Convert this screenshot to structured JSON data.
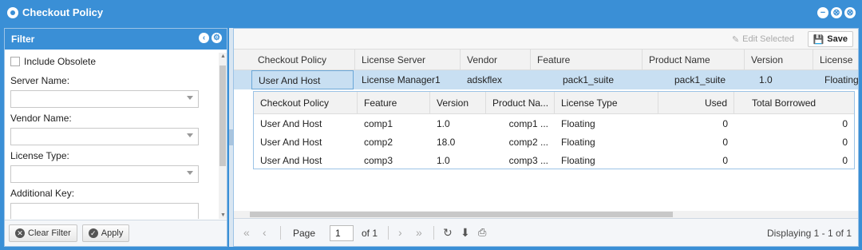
{
  "window": {
    "title": "Checkout Policy",
    "buttons": [
      "−",
      "⊗",
      "⊗"
    ]
  },
  "filter": {
    "title": "Filter",
    "include_obsolete": "Include Obsolete",
    "fields": [
      {
        "label": "Server Name:",
        "value": ""
      },
      {
        "label": "Vendor Name:",
        "value": ""
      },
      {
        "label": "License Type:",
        "value": ""
      },
      {
        "label": "Additional Key:",
        "value": ""
      }
    ],
    "clear_label": "Clear Filter",
    "apply_label": "Apply"
  },
  "toolbar": {
    "edit_label": "Edit Selected",
    "save_label": "Save"
  },
  "grid": {
    "columns": [
      "Checkout Policy",
      "License Server",
      "Vendor",
      "Feature",
      "Product Name",
      "Version",
      "License"
    ],
    "row": [
      "User And Host",
      "License Manager1",
      "adskflex",
      "pack1_suite",
      "pack1_suite",
      "1.0",
      "Floating"
    ]
  },
  "subgrid": {
    "columns": [
      "Checkout Policy",
      "Feature",
      "Version",
      "Product Na...",
      "License Type",
      "Used",
      "Total Borrowed"
    ],
    "rows": [
      [
        "User And Host",
        "comp1",
        "1.0",
        "comp1 ...",
        "Floating",
        "0",
        "0"
      ],
      [
        "User And Host",
        "comp2",
        "18.0",
        "comp2 ...",
        "Floating",
        "0",
        "0"
      ],
      [
        "User And Host",
        "comp3",
        "1.0",
        "comp3 ...",
        "Floating",
        "0",
        "0"
      ]
    ]
  },
  "pager": {
    "page_label": "Page",
    "page_value": "1",
    "of_label": "of 1",
    "display": "Displaying 1 - 1 of 1"
  }
}
